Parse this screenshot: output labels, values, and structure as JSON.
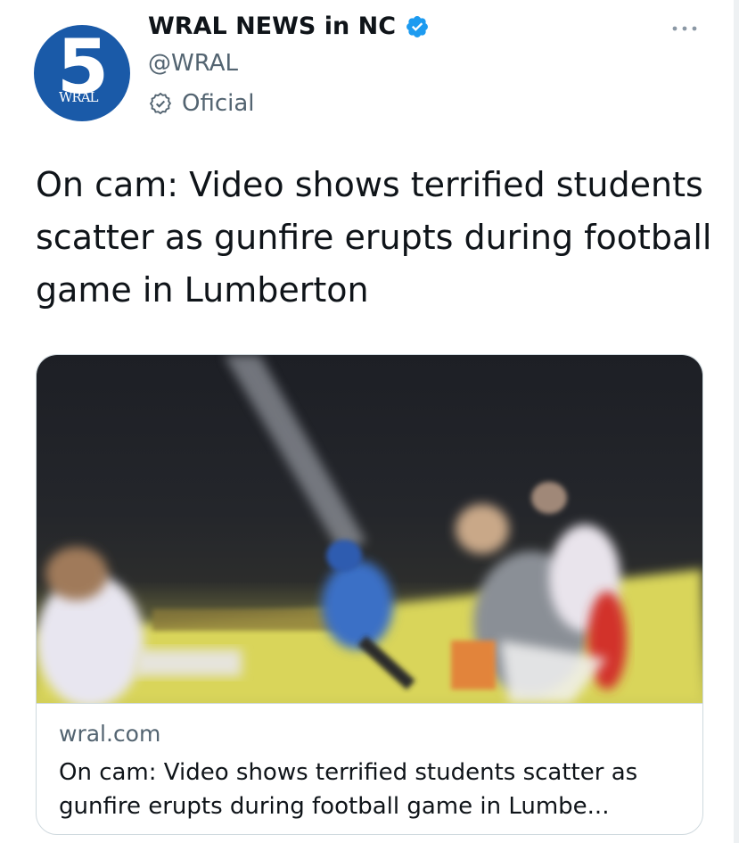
{
  "account": {
    "display_name": "WRAL NEWS in NC",
    "handle": "@WRAL",
    "label": "Oficial",
    "avatar_number": "5",
    "avatar_brand": "WRAL"
  },
  "tweet": {
    "text": "On cam: Video shows terrified students scatter as gunfire erupts during football game in Lumberton"
  },
  "card": {
    "domain": "wral.com",
    "title": "On cam: Video shows terrified students scatter as gunfire erupts during football game in Lumbe..."
  },
  "colors": {
    "verified_blue": "#1d9bf0",
    "secondary_text": "#536471",
    "avatar_blue": "#1a5aa8"
  },
  "icons": {
    "verified": "verified-badge-icon",
    "official": "official-check-icon",
    "more": "more-options-icon"
  }
}
